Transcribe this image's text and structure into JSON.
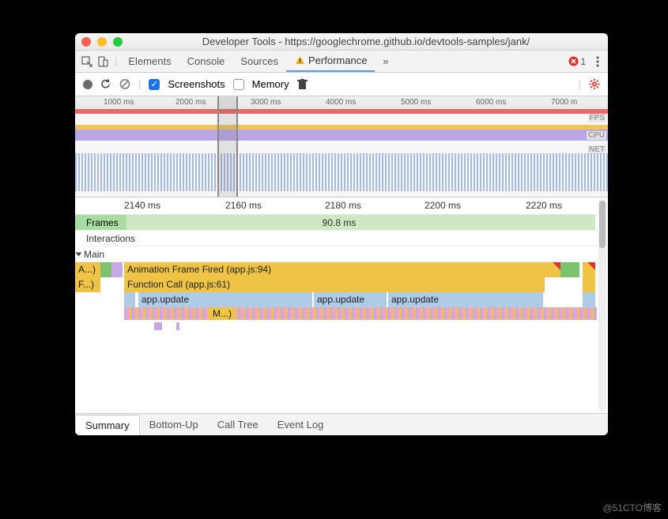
{
  "window": {
    "title": "Developer Tools - https://googlechrome.github.io/devtools-samples/jank/"
  },
  "tabs": {
    "items": [
      "Elements",
      "Console",
      "Sources"
    ],
    "selected": "Performance",
    "error_count": "1"
  },
  "toolbar": {
    "screenshots_label": "Screenshots",
    "memory_label": "Memory"
  },
  "overview": {
    "ticks": [
      "1000 ms",
      "2000 ms",
      "3000 ms",
      "4000 ms",
      "5000 ms",
      "6000 ms",
      "7000 m"
    ],
    "labels": {
      "fps": "FPS",
      "cpu": "CPU",
      "net": "NET"
    }
  },
  "detail": {
    "ruler": [
      "2140 ms",
      "2160 ms",
      "2180 ms",
      "2200 ms",
      "2220 ms"
    ],
    "frames_label": "Frames",
    "frames_value": "90.8 ms",
    "interactions_label": "Interactions",
    "main_label": "Main",
    "rows": {
      "stub_a": "A...)",
      "stub_f": "F...)",
      "anim": "Animation Frame Fired (app.js:94)",
      "func": "Function Call (app.js:61)",
      "upd1": "app.update",
      "upd2": "app.update",
      "upd3": "app.update",
      "stub_m": "M...)"
    }
  },
  "bottom_tabs": [
    "Summary",
    "Bottom-Up",
    "Call Tree",
    "Event Log"
  ],
  "watermark": "@51CTO博客"
}
